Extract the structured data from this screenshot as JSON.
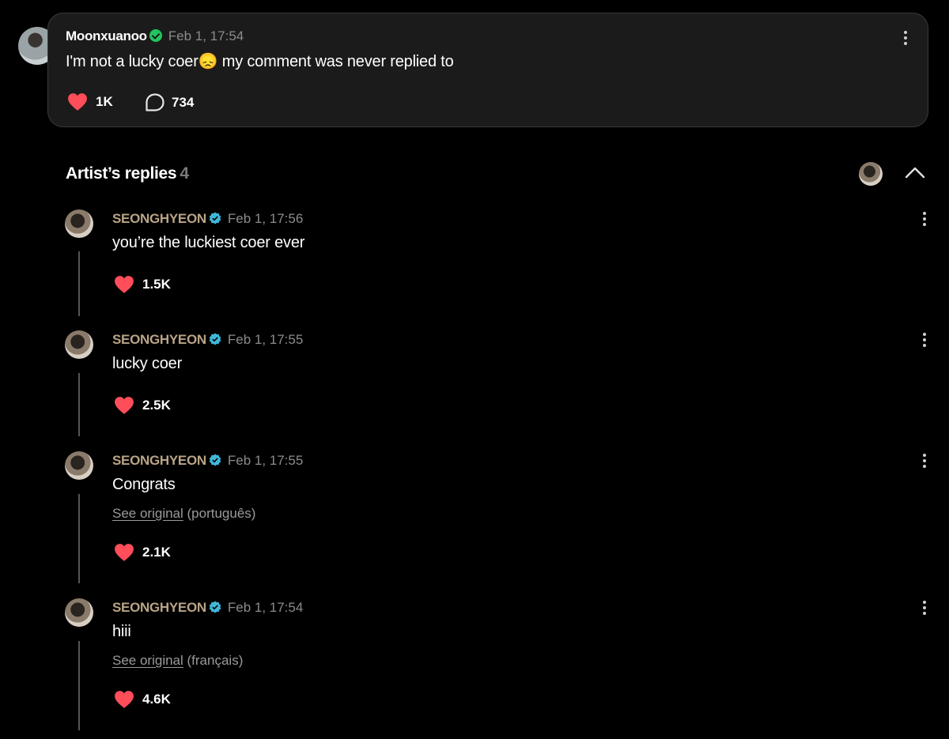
{
  "comment": {
    "author": "Moonxuanoo",
    "date": "Feb 1, 17:54",
    "text_before_emoji": "I'm not a lucky coer",
    "emoji": "😞",
    "text_after_emoji": " my comment was never replied to",
    "likes": "1K",
    "replies": "734"
  },
  "section": {
    "title": "Artist’s replies",
    "count": "4"
  },
  "replies": [
    {
      "author": "SEONGHYEON",
      "date": "Feb 1, 17:56",
      "text": "you’re the luckiest coer ever",
      "likes": "1.5K"
    },
    {
      "author": "SEONGHYEON",
      "date": "Feb 1, 17:55",
      "text": "lucky coer",
      "likes": "2.5K"
    },
    {
      "author": "SEONGHYEON",
      "date": "Feb 1, 17:55",
      "text": "Congrats",
      "see_original": "See original",
      "language": "(português)",
      "likes": "2.1K"
    },
    {
      "author": "SEONGHYEON",
      "date": "Feb 1, 17:54",
      "text": "hiii",
      "see_original": "See original",
      "language": "(français)",
      "likes": "4.6K"
    }
  ],
  "colors": {
    "background": "#000000",
    "card": "#1b1b1b",
    "heart": "#ff4d5a",
    "artist_name": "#b9a486",
    "verified_blue": "#3fb8d8",
    "verified_green": "#22c55e"
  },
  "icons": [
    "heart-icon",
    "comment-bubble-icon",
    "verified-icon",
    "more-options-icon",
    "chevron-up-icon"
  ]
}
